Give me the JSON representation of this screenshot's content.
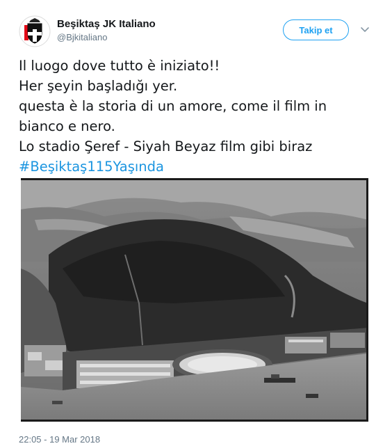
{
  "tweet": {
    "display_name": "Beşiktaş JK Italiano",
    "handle": "@Bjkitaliano",
    "follow_label": "Takip et",
    "lines": [
      "Il luogo dove tutto è iniziato!!",
      "Her şeyin başladığı yer.",
      "questa è la storia di un amore, come il film in",
      "bianco e nero.",
      "Lo stadio Şeref - Siyah Beyaz film gibi biraz"
    ],
    "hashtag": "#Beşiktaş115Yaşında",
    "timestamp": "22:05 - 19 Mar 2018"
  },
  "icons": {
    "avatar": "bjk-eagle-crest-icon",
    "menu": "chevron-down-icon"
  },
  "colors": {
    "accent": "#1da1f2",
    "hashtag": "#1b95e0",
    "secondary_text": "#657786"
  }
}
